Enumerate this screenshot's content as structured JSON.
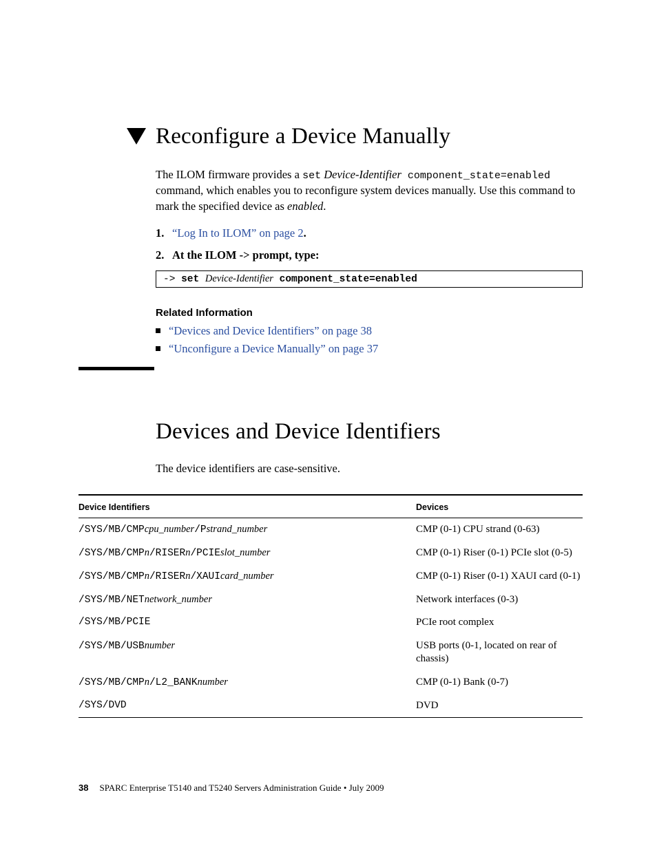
{
  "section1": {
    "title": "Reconfigure a Device Manually",
    "intro_pre": "The ILOM firmware provides a ",
    "intro_cmd": "set",
    "intro_dev": "Device-Identifier",
    "intro_suffix1": " component_state=enabled",
    "intro_line2": " command, which enables you to reconfigure system devices manually. Use this command to mark the specified device as ",
    "intro_enabled": "enabled",
    "intro_period": ".",
    "steps": {
      "s1_num": "1.",
      "s1_link": "“Log In to ILOM” on page 2",
      "s1_period": ".",
      "s2_num": "2.",
      "s2_text": "At the ILOM -> prompt, type:"
    },
    "cmd": {
      "prompt": "-> ",
      "set": "set ",
      "dev": "Device-Identifier",
      "rest": " component_state=enabled"
    },
    "related_heading": "Related Information",
    "related": [
      "“Devices and Device Identifiers” on page 38",
      "“Unconfigure a Device Manually” on page 37"
    ]
  },
  "section2": {
    "title": "Devices and Device Identifiers",
    "intro": "The device identifiers are case-sensitive.",
    "headers": {
      "col1": "Device Identifiers",
      "col2": "Devices"
    },
    "rows": [
      {
        "id_parts": [
          "/SYS/MB/CMP",
          {
            "it": "cpu_number"
          },
          "/P",
          {
            "it": "strand_number"
          }
        ],
        "dev": "CMP (0-1) CPU strand (0-63)"
      },
      {
        "id_parts": [
          "/SYS/MB/CMP",
          {
            "it": "n"
          },
          "/RISER",
          {
            "it": "n"
          },
          "/PCIE",
          {
            "it": "slot_number"
          }
        ],
        "dev": "CMP (0-1) Riser (0-1) PCIe slot (0-5)"
      },
      {
        "id_parts": [
          "/SYS/MB/CMP",
          {
            "it": "n"
          },
          "/RISER",
          {
            "it": "n"
          },
          "/XAUI",
          {
            "it": "card_number"
          }
        ],
        "dev": "CMP (0-1) Riser (0-1) XAUI card (0-1)"
      },
      {
        "id_parts": [
          "/SYS/MB/NET",
          {
            "it": "network_number"
          }
        ],
        "dev": "Network interfaces (0-3)"
      },
      {
        "id_parts": [
          "/SYS/MB/PCIE"
        ],
        "dev": "PCIe root complex"
      },
      {
        "id_parts": [
          "/SYS/MB/USB",
          {
            "it": "number"
          }
        ],
        "dev": "USB ports (0-1, located on rear of chassis)"
      },
      {
        "id_parts": [
          "/SYS/MB/CMP",
          {
            "it": "n"
          },
          "/L2_BANK",
          {
            "it": "number"
          }
        ],
        "dev": "CMP (0-1) Bank (0-7)"
      },
      {
        "id_parts": [
          "/SYS/DVD"
        ],
        "dev": "DVD"
      }
    ]
  },
  "footer": {
    "page": "38",
    "text": "SPARC Enterprise T5140 and T5240 Servers Administration Guide  •  July 2009"
  }
}
